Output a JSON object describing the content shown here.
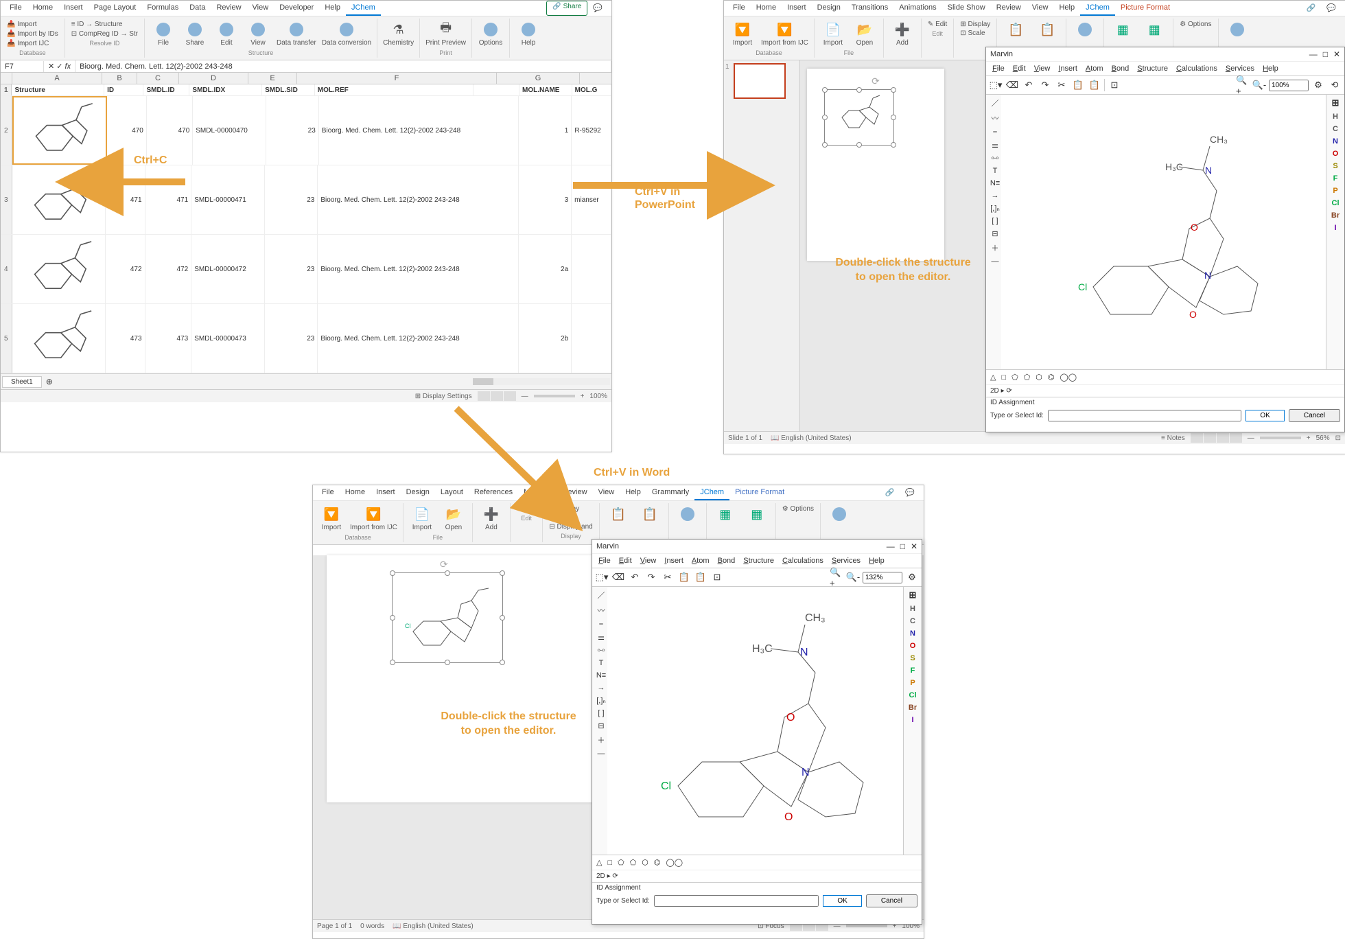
{
  "excel": {
    "tabs": [
      "File",
      "Home",
      "Insert",
      "Page Layout",
      "Formulas",
      "Data",
      "Review",
      "View",
      "Developer",
      "Help",
      "JChem"
    ],
    "share": "Share",
    "db": {
      "import": "Import",
      "importids": "Import by IDs",
      "importijc": "Import IJC",
      "label": "Database"
    },
    "resolve": {
      "idstruct": "ID → Structure",
      "compreg": "CompReg ID → Str",
      "label": "Resolve ID"
    },
    "structure": {
      "file": "File",
      "share": "Share",
      "edit": "Edit",
      "view": "View",
      "transfer": "Data transfer",
      "conv": "Data conversion",
      "label": "Structure"
    },
    "chem": "Chemistry",
    "preview": "Print Preview",
    "options": "Options",
    "help": "Help",
    "print": "Print",
    "cellref": "F7",
    "fx": "fx",
    "formula": "Bioorg. Med. Chem. Lett. 12(2)-2002 243-248",
    "cols": [
      "Structure",
      "ID",
      "SMDL.ID",
      "SMDL.IDX",
      "SMDL.SID",
      "MOL.REF",
      "",
      "MOL.NAME",
      "MOL.G"
    ],
    "colletters": [
      "A",
      "B",
      "C",
      "D",
      "E",
      "F",
      "G"
    ],
    "rows": [
      {
        "n": 2,
        "id": "470",
        "smdlid": "470",
        "idx": "SMDL-00000470",
        "sid": "23",
        "ref": "Bioorg. Med. Chem. Lett. 12(2)-2002 243-248",
        "name": "1",
        "gn": "R-95292"
      },
      {
        "n": 3,
        "id": "471",
        "smdlid": "471",
        "idx": "SMDL-00000471",
        "sid": "23",
        "ref": "Bioorg. Med. Chem. Lett. 12(2)-2002 243-248",
        "name": "3",
        "gn": "mianser"
      },
      {
        "n": 4,
        "id": "472",
        "smdlid": "472",
        "idx": "SMDL-00000472",
        "sid": "23",
        "ref": "Bioorg. Med. Chem. Lett. 12(2)-2002 243-248",
        "name": "2a",
        "gn": ""
      },
      {
        "n": 5,
        "id": "473",
        "smdlid": "473",
        "idx": "SMDL-00000473",
        "sid": "23",
        "ref": "Bioorg. Med. Chem. Lett. 12(2)-2002 243-248",
        "name": "2b",
        "gn": ""
      }
    ],
    "sheet": "Sheet1",
    "display": "Display Settings",
    "zoom": "100%"
  },
  "ppt": {
    "tabs": [
      "File",
      "Home",
      "Insert",
      "Design",
      "Transitions",
      "Animations",
      "Slide Show",
      "Review",
      "View",
      "Help",
      "JChem",
      "Picture Format"
    ],
    "db": {
      "import": "Import",
      "ijc": "Import from IJC",
      "label": "Database"
    },
    "file": {
      "import": "Import",
      "open": "Open",
      "label": "File"
    },
    "add": "Add",
    "edit": "Edit",
    "editlbl": "Edit",
    "display": "Display",
    "scale": "Scale",
    "options": "Options",
    "status": "Slide 1 of 1",
    "lang": "English (United States)",
    "notes": "Notes",
    "zoom": "56%"
  },
  "word": {
    "tabs": [
      "File",
      "Home",
      "Insert",
      "Design",
      "Layout",
      "References",
      "Mailings",
      "Review",
      "View",
      "Help",
      "Grammarly",
      "JChem",
      "Picture Format"
    ],
    "db": {
      "import": "Import",
      "ijc": "Import from IJC",
      "label": "Database"
    },
    "file": {
      "import": "Import",
      "open": "Open",
      "label": "File"
    },
    "add": "Add",
    "edit": "Edit",
    "editlbl": "Edit",
    "display": "Display",
    "scale": "Scale",
    "displayand": "Display and",
    "dlabel": "Display",
    "status": "Page 1 of 1",
    "words": "0 words",
    "lang": "English (United States)",
    "focus": "Focus",
    "zoom": "100%"
  },
  "marvin": {
    "title": "Marvin",
    "menus": [
      "File",
      "Edit",
      "View",
      "Insert",
      "Atom",
      "Bond",
      "Structure",
      "Calculations",
      "Services",
      "Help"
    ],
    "zoom1": "100%",
    "zoom2": "132%",
    "atoms": [
      "H",
      "C",
      "N",
      "O",
      "S",
      "F",
      "P",
      "Cl",
      "Br",
      "I"
    ],
    "atomcols": {
      "H": "#555",
      "C": "#555",
      "N": "#2222aa",
      "O": "#cc0000",
      "S": "#998800",
      "F": "#00aa44",
      "P": "#cc7700",
      "Cl": "#00aa44",
      "Br": "#884422",
      "I": "#6600aa"
    },
    "id": "ID Assignment",
    "typeid": "Type or Select Id:",
    "ok": "OK",
    "cancel": "Cancel",
    "2d": "2D"
  },
  "annot": {
    "ctrlc": "Ctrl+C",
    "ctrlvppt": "Ctrl+V in PowerPoint",
    "ctrlvword": "Ctrl+V in Word",
    "dblclick": "Double-click the structure to open the editor."
  }
}
